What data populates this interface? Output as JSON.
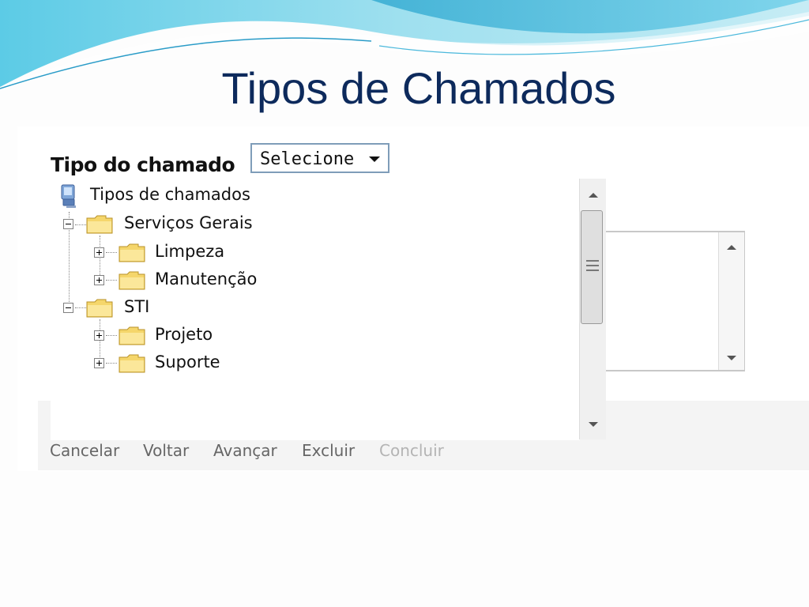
{
  "slide": {
    "title": "Tipos de Chamados"
  },
  "form": {
    "label": "Tipo do chamado",
    "select": {
      "value": "Selecione"
    }
  },
  "tree": {
    "root": "Tipos de chamados",
    "nodes": [
      {
        "label": "Serviços Gerais",
        "expanded": true,
        "children": [
          "Limpeza",
          "Manutenção"
        ]
      },
      {
        "label": "STI",
        "expanded": true,
        "children": [
          "Projeto",
          "Suporte"
        ]
      }
    ]
  },
  "actions": {
    "cancel": "Cancelar",
    "back": "Voltar",
    "next": "Avançar",
    "delete": "Excluir",
    "finish": "Concluir"
  },
  "colors": {
    "title": "#0d2a5c",
    "accent_wave": "#3db4d8",
    "select_border": "#7f9db9",
    "folder": "#f5d66b"
  }
}
